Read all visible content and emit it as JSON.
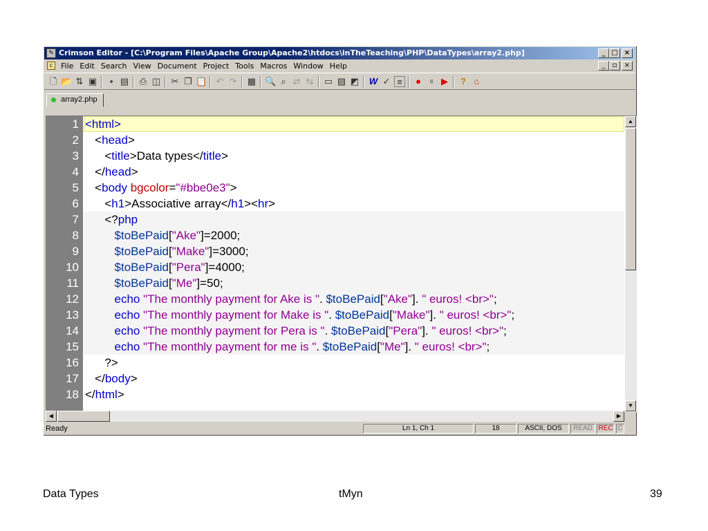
{
  "window": {
    "title": "Crimson Editor - [C:\\Program Files\\Apache Group\\Apache2\\htdocs\\inTheTeaching\\PHP\\DataTypes\\array2.php]",
    "caption_buttons": [
      "_",
      "□",
      "×"
    ],
    "mdi_buttons": [
      "_",
      "▫",
      "×"
    ]
  },
  "menu": [
    "File",
    "Edit",
    "Search",
    "View",
    "Document",
    "Project",
    "Tools",
    "Macros",
    "Window",
    "Help"
  ],
  "tab": {
    "label": "array2.php"
  },
  "editor": {
    "line_numbers": [
      "1",
      "2",
      "3",
      "4",
      "5",
      "6",
      "7",
      "8",
      "9",
      "10",
      "11",
      "12",
      "13",
      "14",
      "15",
      "16",
      "17",
      "18"
    ],
    "lines": [
      [
        {
          "t": "tag",
          "v": "<html>"
        }
      ],
      [
        {
          "t": "txt",
          "v": "   "
        },
        {
          "t": "br",
          "v": "<"
        },
        {
          "t": "tag",
          "v": "head"
        },
        {
          "t": "br",
          "v": ">"
        }
      ],
      [
        {
          "t": "txt",
          "v": "      "
        },
        {
          "t": "br",
          "v": "<"
        },
        {
          "t": "tag",
          "v": "title"
        },
        {
          "t": "br",
          "v": ">"
        },
        {
          "t": "txt",
          "v": "Data types"
        },
        {
          "t": "br",
          "v": "</"
        },
        {
          "t": "tag",
          "v": "title"
        },
        {
          "t": "br",
          "v": ">"
        }
      ],
      [
        {
          "t": "txt",
          "v": "   "
        },
        {
          "t": "br",
          "v": "</"
        },
        {
          "t": "tag",
          "v": "head"
        },
        {
          "t": "br",
          "v": ">"
        }
      ],
      [
        {
          "t": "txt",
          "v": "   "
        },
        {
          "t": "br",
          "v": "<"
        },
        {
          "t": "tag",
          "v": "body "
        },
        {
          "t": "attr",
          "v": "bgcolor"
        },
        {
          "t": "br",
          "v": "="
        },
        {
          "t": "str",
          "v": "\"#bbe0e3\""
        },
        {
          "t": "br",
          "v": ">"
        }
      ],
      [
        {
          "t": "txt",
          "v": "      "
        },
        {
          "t": "br",
          "v": "<"
        },
        {
          "t": "tag",
          "v": "h1"
        },
        {
          "t": "br",
          "v": ">"
        },
        {
          "t": "txt",
          "v": "Associative array"
        },
        {
          "t": "br",
          "v": "</"
        },
        {
          "t": "tag",
          "v": "h1"
        },
        {
          "t": "br",
          "v": "><"
        },
        {
          "t": "tag",
          "v": "hr"
        },
        {
          "t": "br",
          "v": ">"
        }
      ],
      [
        {
          "t": "txt",
          "v": "      "
        },
        {
          "t": "br",
          "v": "<?"
        },
        {
          "t": "kw",
          "v": "php"
        }
      ],
      [
        {
          "t": "txt",
          "v": "         "
        },
        {
          "t": "var",
          "v": "$toBePaid"
        },
        {
          "t": "br",
          "v": "["
        },
        {
          "t": "str",
          "v": "\"Ake\""
        },
        {
          "t": "br",
          "v": "]=2000;"
        }
      ],
      [
        {
          "t": "txt",
          "v": "         "
        },
        {
          "t": "var",
          "v": "$toBePaid"
        },
        {
          "t": "br",
          "v": "["
        },
        {
          "t": "str",
          "v": "\"Make\""
        },
        {
          "t": "br",
          "v": "]=3000;"
        }
      ],
      [
        {
          "t": "txt",
          "v": "         "
        },
        {
          "t": "var",
          "v": "$toBePaid"
        },
        {
          "t": "br",
          "v": "["
        },
        {
          "t": "str",
          "v": "\"Pera\""
        },
        {
          "t": "br",
          "v": "]=4000;"
        }
      ],
      [
        {
          "t": "txt",
          "v": "         "
        },
        {
          "t": "var",
          "v": "$toBePaid"
        },
        {
          "t": "br",
          "v": "["
        },
        {
          "t": "str",
          "v": "\"Me\""
        },
        {
          "t": "br",
          "v": "]=50;"
        }
      ],
      [
        {
          "t": "txt",
          "v": "         "
        },
        {
          "t": "kw",
          "v": "echo "
        },
        {
          "t": "str",
          "v": "\"The monthly payment for Ake is \""
        },
        {
          "t": "br",
          "v": ". "
        },
        {
          "t": "var",
          "v": "$toBePaid"
        },
        {
          "t": "br",
          "v": "["
        },
        {
          "t": "str",
          "v": "\"Ake\""
        },
        {
          "t": "br",
          "v": "]. "
        },
        {
          "t": "str",
          "v": "\" euros! <br>\""
        },
        {
          "t": "br",
          "v": ";"
        }
      ],
      [
        {
          "t": "txt",
          "v": "         "
        },
        {
          "t": "kw",
          "v": "echo "
        },
        {
          "t": "str",
          "v": "\"The monthly payment for Make is \""
        },
        {
          "t": "br",
          "v": ". "
        },
        {
          "t": "var",
          "v": "$toBePaid"
        },
        {
          "t": "br",
          "v": "["
        },
        {
          "t": "str",
          "v": "\"Make\""
        },
        {
          "t": "br",
          "v": "]. "
        },
        {
          "t": "str",
          "v": "\" euros! <br>\""
        },
        {
          "t": "br",
          "v": ";"
        }
      ],
      [
        {
          "t": "txt",
          "v": "         "
        },
        {
          "t": "kw",
          "v": "echo "
        },
        {
          "t": "str",
          "v": "\"The monthly payment for Pera is \""
        },
        {
          "t": "br",
          "v": ". "
        },
        {
          "t": "var",
          "v": "$toBePaid"
        },
        {
          "t": "br",
          "v": "["
        },
        {
          "t": "str",
          "v": "\"Pera\""
        },
        {
          "t": "br",
          "v": "]. "
        },
        {
          "t": "str",
          "v": "\" euros! <br>\""
        },
        {
          "t": "br",
          "v": ";"
        }
      ],
      [
        {
          "t": "txt",
          "v": "         "
        },
        {
          "t": "kw",
          "v": "echo "
        },
        {
          "t": "str",
          "v": "\"The monthly payment for me is \""
        },
        {
          "t": "br",
          "v": ". "
        },
        {
          "t": "var",
          "v": "$toBePaid"
        },
        {
          "t": "br",
          "v": "["
        },
        {
          "t": "str",
          "v": "\"Me\""
        },
        {
          "t": "br",
          "v": "]. "
        },
        {
          "t": "str",
          "v": "\" euros! <br>\""
        },
        {
          "t": "br",
          "v": ";"
        }
      ],
      [
        {
          "t": "txt",
          "v": "      "
        },
        {
          "t": "br",
          "v": "?>"
        }
      ],
      [
        {
          "t": "txt",
          "v": "   "
        },
        {
          "t": "br",
          "v": "</"
        },
        {
          "t": "tag",
          "v": "body"
        },
        {
          "t": "br",
          "v": ">"
        }
      ],
      [
        {
          "t": "br",
          "v": "</"
        },
        {
          "t": "tag",
          "v": "html"
        },
        {
          "t": "br",
          "v": ">"
        }
      ]
    ]
  },
  "status": {
    "ready": "Ready",
    "position": "Ln 1, Ch 1",
    "line_count": "18",
    "encoding": "ASCII, DOS",
    "read": "READ",
    "rec": "REC",
    "col": "C"
  },
  "footer": {
    "left": "Data Types",
    "center": "tMyn",
    "right": "39"
  }
}
